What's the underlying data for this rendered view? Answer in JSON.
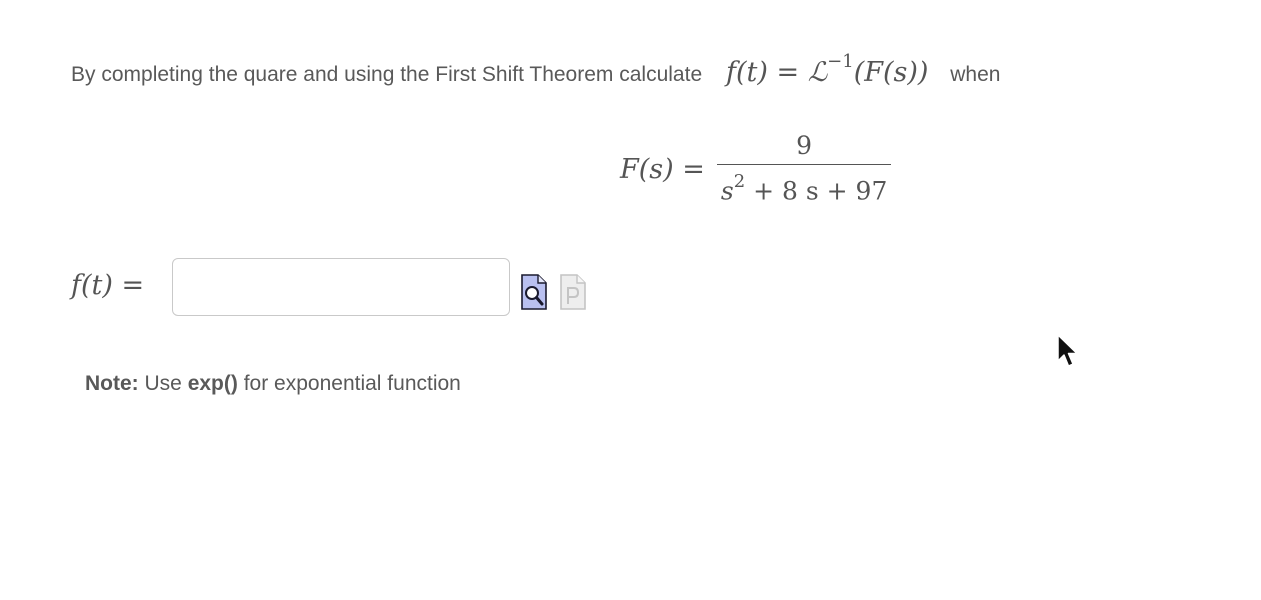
{
  "question": {
    "prefix": "By completing the quare and using the First Shift Theorem calculate",
    "formula_lhs": "f(t)",
    "formula_eq": " = ",
    "laplace": "ℒ",
    "laplace_exp": "−1",
    "formula_arg": "(F(s))",
    "suffix": "when"
  },
  "display_equation": {
    "lhs": "F(s) =",
    "numerator": "9",
    "den_base": "s",
    "den_exp": "2",
    "den_rest": " + 8 s + 97"
  },
  "answer": {
    "label": "f(t) =",
    "value": "",
    "placeholder": ""
  },
  "tools": {
    "preview_icon": "preview-magnifier-icon",
    "problem_icon": "problem-page-icon"
  },
  "note": {
    "bold_label": "Note:",
    "text_before": " Use ",
    "bold_function": "exp()",
    "text_after": " for exponential function"
  },
  "colors": {
    "text": "#595959",
    "input_border": "#c9c9c9",
    "icon_blue": "#b9c0f0"
  }
}
